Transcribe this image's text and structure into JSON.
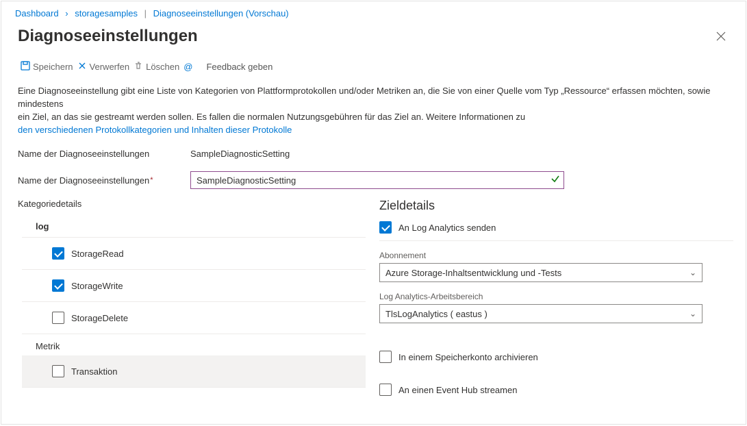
{
  "breadcrumb": {
    "dashboard": "Dashboard",
    "resource": "storagesamples",
    "page": "Diagnoseeinstellungen (Vorschau)"
  },
  "title": "Diagnoseeinstellungen",
  "toolbar": {
    "save": "Speichern",
    "discard": "Verwerfen",
    "delete": "Löschen",
    "feedback": "Feedback geben"
  },
  "description": {
    "line1": "Eine Diagnoseeinstellung gibt eine Liste von Kategorien von Plattformprotokollen und/oder Metriken an, die Sie von einer Quelle vom Typ „Ressource“ erfassen möchten, sowie mindestens",
    "line2": " ein Ziel, an das sie gestreamt werden sollen. Es fallen die normalen Nutzungsgebühren für das Ziel an. Weitere Informationen zu",
    "link": "den verschiedenen Protokollkategorien und Inhalten dieser Protokolle"
  },
  "form": {
    "nameLabel1": "Name der Diagnoseeinstellungen",
    "nameValueDisplay": "SampleDiagnosticSetting",
    "nameLabel2": "Name der Diagnoseeinstellungen",
    "nameInputValue": "SampleDiagnosticSetting"
  },
  "categories": {
    "title": "Kategoriedetails",
    "logHeader": "log",
    "items": [
      {
        "label": "StorageRead",
        "checked": true
      },
      {
        "label": "StorageWrite",
        "checked": true
      },
      {
        "label": "StorageDelete",
        "checked": false
      }
    ],
    "metricHeader": "Metrik",
    "metricItems": [
      {
        "label": "Transaktion",
        "checked": false
      }
    ]
  },
  "destinations": {
    "title": "Zieldetails",
    "logAnalytics": {
      "label": "An Log Analytics senden",
      "checked": true,
      "subscriptionLabel": "Abonnement",
      "subscriptionValue": "Azure Storage-Inhaltsentwicklung und -Tests",
      "workspaceLabel": "Log Analytics-Arbeitsbereich",
      "workspaceValue": "TlsLogAnalytics ( eastus )"
    },
    "storageAccount": {
      "label": "In einem Speicherkonto archivieren",
      "checked": false
    },
    "eventHub": {
      "label": "An einen Event Hub streamen",
      "checked": false
    }
  }
}
